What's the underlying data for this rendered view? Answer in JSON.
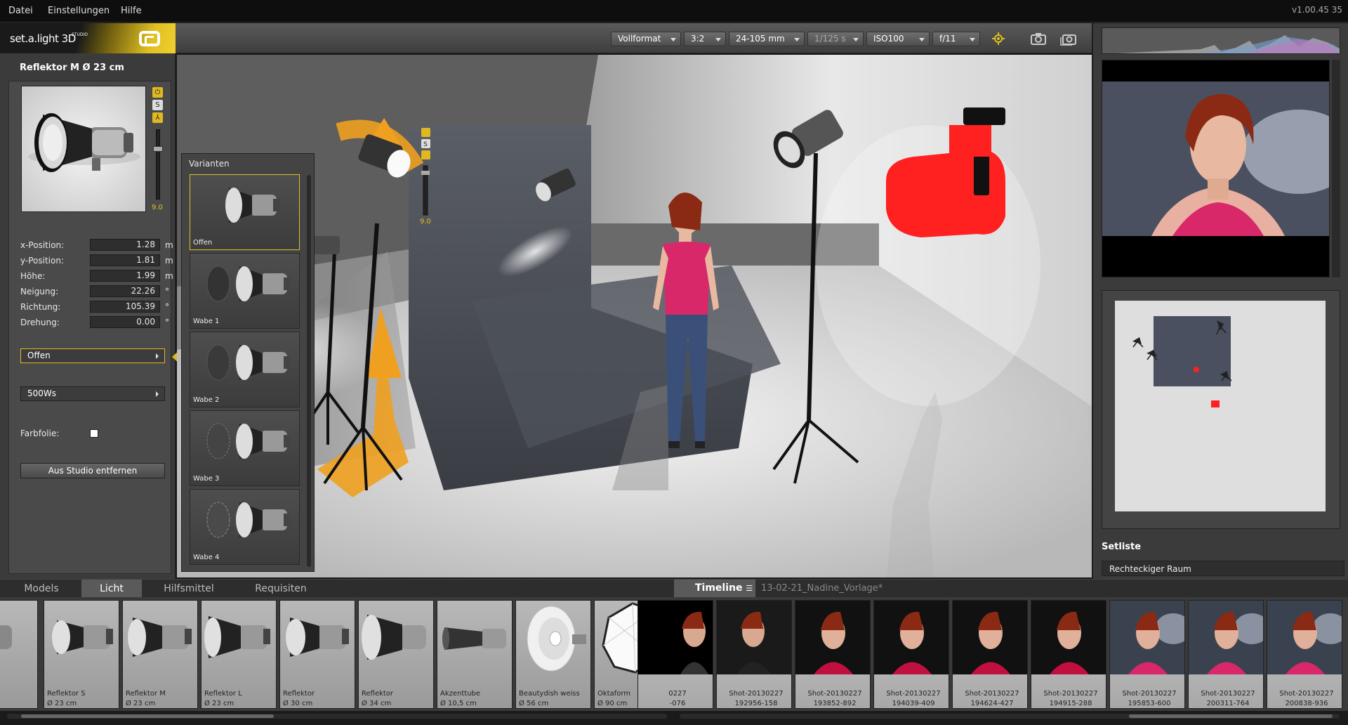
{
  "menu": {
    "items": [
      "Datei",
      "Einstellungen",
      "Hilfe"
    ],
    "version": "v1.00.45  35"
  },
  "logo": {
    "text": "set.a.light 3D",
    "sub": "STUDIO"
  },
  "toolbar": {
    "format": "Vollformat",
    "ratio": "3:2",
    "lens": "24-105 mm",
    "shutter": "1/125 s",
    "iso": "ISO100",
    "aperture": "f/11"
  },
  "left": {
    "title": "Reflektor M Ø 23 cm",
    "slider_value": "9.0",
    "props": [
      {
        "label": "x-Position:",
        "value": "1.28",
        "unit": "m"
      },
      {
        "label": "y-Position:",
        "value": "1.81",
        "unit": "m"
      },
      {
        "label": "Höhe:",
        "value": "1.99",
        "unit": "m"
      },
      {
        "label": "Neigung:",
        "value": "22.26",
        "unit": "°"
      },
      {
        "label": "Richtung:",
        "value": "105.39",
        "unit": "°"
      },
      {
        "label": "Drehung:",
        "value": "0.00",
        "unit": "°"
      }
    ],
    "variant_select": "Offen",
    "power_select": "500Ws",
    "farbfolie_label": "Farbfolie:",
    "remove_button": "Aus Studio entfernen"
  },
  "variants": {
    "title": "Varianten",
    "items": [
      "Offen",
      "Wabe 1",
      "Wabe 2",
      "Wabe 3",
      "Wabe 4"
    ]
  },
  "scene": {
    "gizmo_value": "9.0"
  },
  "right": {
    "setliste_label": "Setliste",
    "setliste_value": "Rechteckiger Raum"
  },
  "bottom_tabs": [
    "Models",
    "Licht",
    "Hilfsmittel",
    "Requisiten"
  ],
  "timeline": {
    "tab": "Timeline",
    "project": "13-02-21_Nadine_Vorlage*"
  },
  "library": [
    {
      "l1": "",
      "l2": ""
    },
    {
      "l1": "Reflektor S",
      "l2": "Ø 23 cm"
    },
    {
      "l1": "Reflektor M",
      "l2": "Ø 23 cm"
    },
    {
      "l1": "Reflektor L",
      "l2": "Ø 23 cm"
    },
    {
      "l1": "Reflektor",
      "l2": "Ø 30 cm"
    },
    {
      "l1": "Reflektor",
      "l2": "Ø 34 cm"
    },
    {
      "l1": "Akzenttube",
      "l2": "Ø 10,5 cm"
    },
    {
      "l1": "Beautydish weiss",
      "l2": "Ø 56 cm"
    },
    {
      "l1": "Oktaform",
      "l2": "Ø 90 cm"
    }
  ],
  "shots": [
    {
      "l1": "0227",
      "l2": "-076"
    },
    {
      "l1": "Shot-20130227",
      "l2": "192956-158"
    },
    {
      "l1": "Shot-20130227",
      "l2": "193852-892"
    },
    {
      "l1": "Shot-20130227",
      "l2": "194039-409"
    },
    {
      "l1": "Shot-20130227",
      "l2": "194624-427"
    },
    {
      "l1": "Shot-20130227",
      "l2": "194915-288"
    },
    {
      "l1": "Shot-20130227",
      "l2": "195853-600"
    },
    {
      "l1": "Shot-20130227",
      "l2": "200311-764"
    },
    {
      "l1": "Shot-20130227",
      "l2": "200838-936"
    }
  ],
  "colors": {
    "accent": "#e0b820",
    "camera": "#ff2020",
    "gizmo": "#f0a020"
  }
}
